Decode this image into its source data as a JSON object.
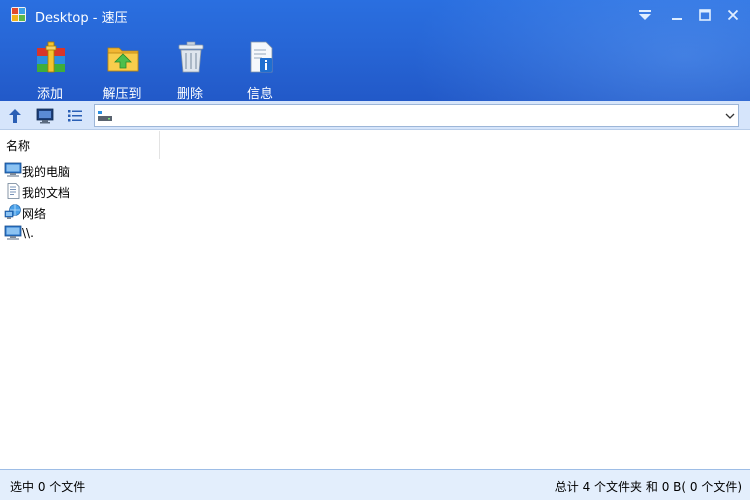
{
  "window": {
    "title": "Desktop - 速压",
    "icons": {
      "app": "archive-app-icon",
      "menu": "dropdown-menu-icon",
      "maximize": "maximize-icon",
      "close": "close-icon"
    }
  },
  "toolbar": {
    "items": [
      {
        "label": "添加",
        "icon": "add-archive-icon"
      },
      {
        "label": "解压到",
        "icon": "extract-folder-icon"
      },
      {
        "label": "删除",
        "icon": "trash-icon"
      },
      {
        "label": "信息",
        "icon": "info-document-icon"
      }
    ]
  },
  "nav": {
    "up_icon": "up-arrow-icon",
    "computer_icon": "computer-icon",
    "view_icon": "list-view-icon",
    "address_value": "",
    "address_icon": "drive-icon"
  },
  "list": {
    "column_name": "名称",
    "items": [
      {
        "label": "我的电脑",
        "icon": "computer-icon"
      },
      {
        "label": "我的文档",
        "icon": "document-icon"
      },
      {
        "label": "网络",
        "icon": "network-icon"
      },
      {
        "label": "\\\\.",
        "icon": "computer-icon"
      }
    ]
  },
  "status": {
    "selected": "选中 0 个文件",
    "total": "总计 4 个文件夹 和 0 B( 0 个文件)"
  },
  "colors": {
    "header_blue": "#2766d6",
    "nav_bg": "#d6e5fb",
    "status_bg": "#e3eefc"
  }
}
